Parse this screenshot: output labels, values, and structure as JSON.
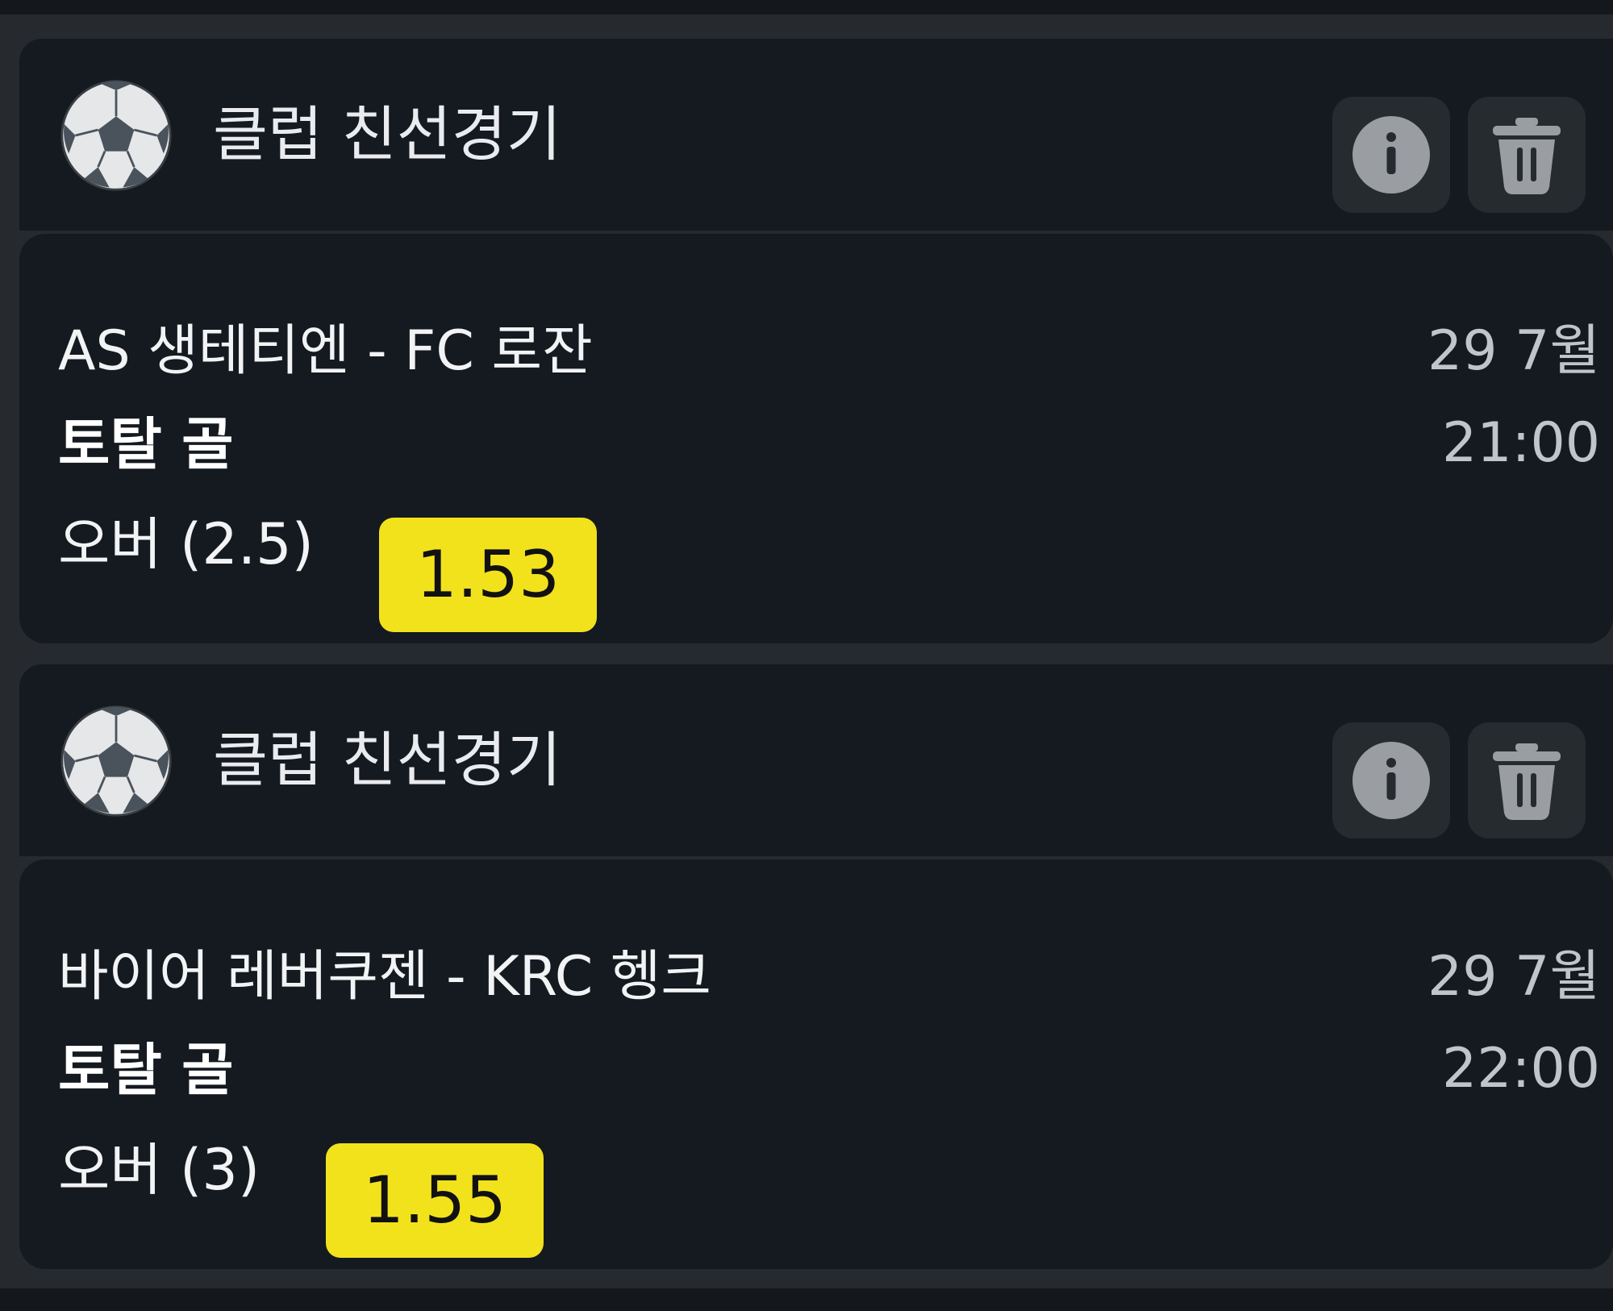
{
  "bets": [
    {
      "league": "클럽 친선경기",
      "match": "AS 생테티엔 - FC 로잔",
      "market": "토탈 골",
      "date": "29 7월",
      "time": "21:00",
      "selection": "오버 (2.5)",
      "odds": "1.53"
    },
    {
      "league": "클럽 친선경기",
      "match": "바이어 레버쿠젠 - KRC 헹크",
      "market": "토탈 골",
      "date": "29 7월",
      "time": "22:00",
      "selection": "오버 (3)",
      "odds": "1.55"
    }
  ],
  "icons": {
    "sport": "soccer-ball-icon",
    "info": "info-icon",
    "delete": "trash-icon"
  },
  "colors": {
    "page_background": "#262a2f",
    "card_background": "#141a20",
    "odds_accent": "#f2e21c",
    "icon_button": "#262b30"
  }
}
